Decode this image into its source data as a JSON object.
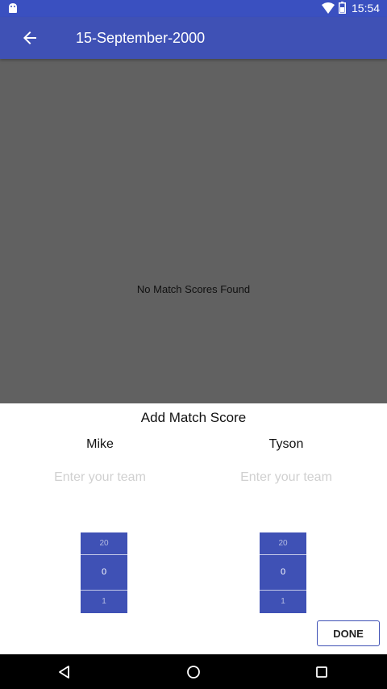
{
  "status_bar": {
    "time": "15:54"
  },
  "app_bar": {
    "title": "15-September-2000"
  },
  "content": {
    "empty_message": "No Match Scores Found"
  },
  "dialog": {
    "title": "Add Match Score",
    "players": [
      {
        "name": "Mike",
        "team_placeholder": "Enter your team",
        "team_value": "",
        "picker": {
          "prev": "20",
          "current": "0",
          "next": "1"
        }
      },
      {
        "name": "Tyson",
        "team_placeholder": "Enter your team",
        "team_value": "",
        "picker": {
          "prev": "20",
          "current": "0",
          "next": "1"
        }
      }
    ],
    "done_label": "DONE"
  },
  "colors": {
    "primary": "#3f51b5",
    "status_bar": "#3a50c0",
    "overlay": "#616161"
  },
  "icons": [
    "android-icon",
    "wifi-icon",
    "battery-icon",
    "back-arrow-icon",
    "nav-back-icon",
    "nav-home-icon",
    "nav-recents-icon"
  ]
}
